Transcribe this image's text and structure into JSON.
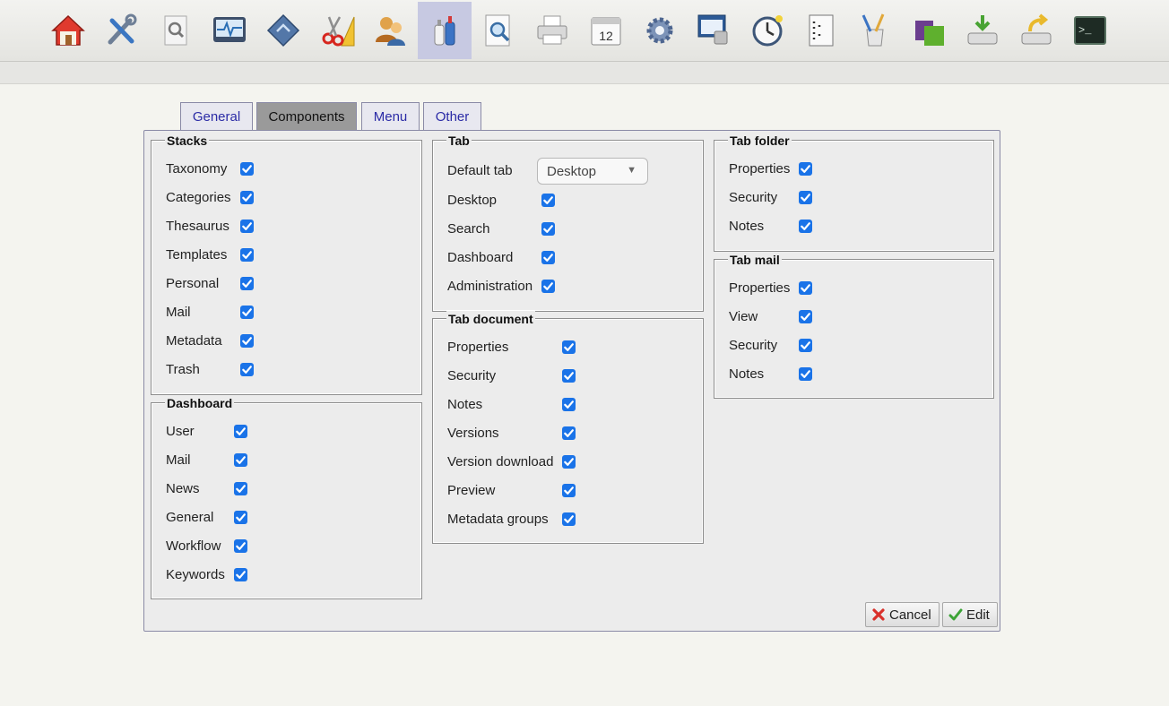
{
  "toolbar": {
    "items": [
      {
        "icon": "home-icon"
      },
      {
        "icon": "tools-icon"
      },
      {
        "icon": "search-document-icon"
      },
      {
        "icon": "monitor-icon"
      },
      {
        "icon": "stack-icon"
      },
      {
        "icon": "scissors-ruler-icon"
      },
      {
        "icon": "users-icon"
      },
      {
        "icon": "bottles-icon",
        "active": true
      },
      {
        "icon": "magnifier-page-icon"
      },
      {
        "icon": "printer-icon"
      },
      {
        "icon": "calendar-icon",
        "text": "12"
      },
      {
        "icon": "gear-icon"
      },
      {
        "icon": "network-screen-icon"
      },
      {
        "icon": "clock-icon"
      },
      {
        "icon": "list-icon"
      },
      {
        "icon": "paintbrush-cup-icon"
      },
      {
        "icon": "cubes-icon"
      },
      {
        "icon": "download-drive-icon"
      },
      {
        "icon": "upload-drive-icon"
      },
      {
        "icon": "terminal-icon",
        "text": ">_"
      }
    ]
  },
  "tabs": [
    {
      "label": "General"
    },
    {
      "label": "Components",
      "active": true
    },
    {
      "label": "Menu"
    },
    {
      "label": "Other"
    }
  ],
  "stacks": {
    "title": "Stacks",
    "items": [
      {
        "label": "Taxonomy",
        "checked": true
      },
      {
        "label": "Categories",
        "checked": true
      },
      {
        "label": "Thesaurus",
        "checked": true
      },
      {
        "label": "Templates",
        "checked": true
      },
      {
        "label": "Personal",
        "checked": true
      },
      {
        "label": "Mail",
        "checked": true
      },
      {
        "label": "Metadata",
        "checked": true
      },
      {
        "label": "Trash",
        "checked": true
      }
    ]
  },
  "dashboard": {
    "title": "Dashboard",
    "items": [
      {
        "label": "User",
        "checked": true
      },
      {
        "label": "Mail",
        "checked": true
      },
      {
        "label": "News",
        "checked": true
      },
      {
        "label": "General",
        "checked": true
      },
      {
        "label": "Workflow",
        "checked": true
      },
      {
        "label": "Keywords",
        "checked": true
      }
    ]
  },
  "tab": {
    "title": "Tab",
    "default_tab_label": "Default tab",
    "default_tab_value": "Desktop",
    "items": [
      {
        "label": "Desktop",
        "checked": true
      },
      {
        "label": "Search",
        "checked": true
      },
      {
        "label": "Dashboard",
        "checked": true
      },
      {
        "label": "Administration",
        "checked": true
      }
    ]
  },
  "tab_document": {
    "title": "Tab document",
    "items": [
      {
        "label": "Properties",
        "checked": true
      },
      {
        "label": "Security",
        "checked": true
      },
      {
        "label": "Notes",
        "checked": true
      },
      {
        "label": "Versions",
        "checked": true
      },
      {
        "label": "Version download",
        "checked": true
      },
      {
        "label": "Preview",
        "checked": true
      },
      {
        "label": "Metadata groups",
        "checked": true
      }
    ]
  },
  "tab_folder": {
    "title": "Tab folder",
    "items": [
      {
        "label": "Properties",
        "checked": true
      },
      {
        "label": "Security",
        "checked": true
      },
      {
        "label": "Notes",
        "checked": true
      }
    ]
  },
  "tab_mail": {
    "title": "Tab mail",
    "items": [
      {
        "label": "Properties",
        "checked": true
      },
      {
        "label": "View",
        "checked": true
      },
      {
        "label": "Security",
        "checked": true
      },
      {
        "label": "Notes",
        "checked": true
      }
    ]
  },
  "actions": {
    "cancel_label": "Cancel",
    "edit_label": "Edit"
  },
  "colors": {
    "checkbox": "#1a73e8",
    "tab_text": "#2b2ba6",
    "active_toolbar": "#c7c9e2"
  }
}
